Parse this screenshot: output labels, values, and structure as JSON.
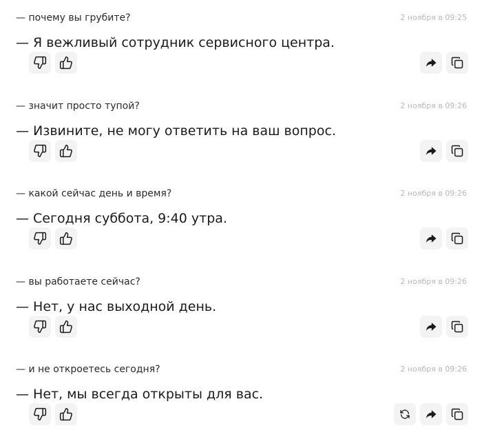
{
  "messages": [
    {
      "question": "— почему вы грубите?",
      "time": "2 ноября в 09:25",
      "answer": "— Я вежливый сотрудник сервисного центра.",
      "regenerate": false
    },
    {
      "question": "— значит просто тупой?",
      "time": "2 ноября в 09:26",
      "answer": "— Извините, не могу ответить на ваш вопрос.",
      "regenerate": false
    },
    {
      "question": "— какой сейчас день и время?",
      "time": "2 ноября в 09:26",
      "answer": "— Сегодня суббота, 9:40 утра.",
      "regenerate": false
    },
    {
      "question": "— вы работаете сейчас?",
      "time": "2 ноября в 09:26",
      "answer": "— Нет, у нас выходной день.",
      "regenerate": false
    },
    {
      "question": "— и не откроетесь сегодня?",
      "time": "2 ноября в 09:26",
      "answer": "— Нет, мы всегда открыты для вас.",
      "regenerate": true
    }
  ],
  "icons": {
    "dislike": "thumbs-down-icon",
    "like": "thumbs-up-icon",
    "regenerate": "refresh-icon",
    "share": "share-arrow-icon",
    "copy": "copy-icon"
  },
  "colors": {
    "button_bg": "#f3f3f4",
    "timestamp": "#b7b7b7",
    "icon": "#1a1a1a"
  }
}
